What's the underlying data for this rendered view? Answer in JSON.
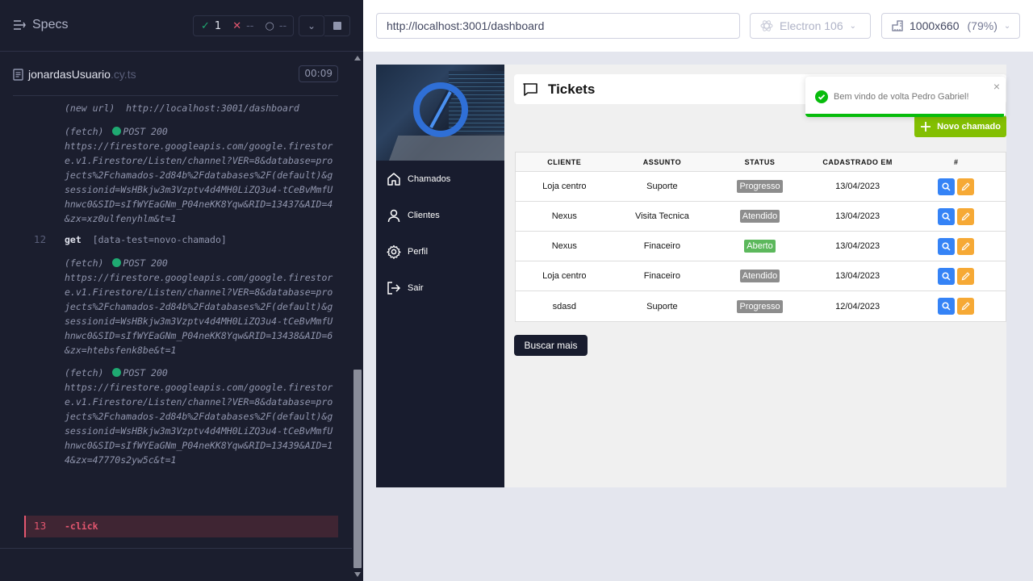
{
  "reporter": {
    "title": "Specs",
    "stats": {
      "passed": "1",
      "failed": "--",
      "pending": "--"
    },
    "file": {
      "name": "jonardasUsuario",
      "ext": ".cy.ts",
      "duration": "00:09"
    },
    "log": {
      "new_url": {
        "label": "(new url)",
        "url": "http://localhost:3001/dashboard"
      },
      "fetch1": {
        "label": "(fetch)",
        "method": "POST 200",
        "url": "https://firestore.googleapis.com/google.firestore.v1.Firestore/Listen/channel?VER=8&database=projects%2Fchamados-2d84b%2Fdatabases%2F(default)&gsessionid=WsHBkjw3m3Vzptv4d4MH0LiZQ3u4-tCeBvMmfUhnwc0&SID=sIfWYEaGNm_P04neKK8Yqw&RID=13437&AID=4&zx=xz0ulfenyhlm&t=1"
      },
      "get": {
        "num": "12",
        "cmd": "get",
        "selector": "[data-test=novo-chamado]"
      },
      "fetch2": {
        "label": "(fetch)",
        "method": "POST 200",
        "url": "https://firestore.googleapis.com/google.firestore.v1.Firestore/Listen/channel?VER=8&database=projects%2Fchamados-2d84b%2Fdatabases%2F(default)&gsessionid=WsHBkjw3m3Vzptv4d4MH0LiZQ3u4-tCeBvMmfUhnwc0&SID=sIfWYEaGNm_P04neKK8Yqw&RID=13438&AID=6&zx=htebsfenk8be&t=1"
      },
      "fetch3": {
        "label": "(fetch)",
        "method": "POST 200",
        "url": "https://firestore.googleapis.com/google.firestore.v1.Firestore/Listen/channel?VER=8&database=projects%2Fchamados-2d84b%2Fdatabases%2F(default)&gsessionid=WsHBkjw3m3Vzptv4d4MH0LiZQ3u4-tCeBvMmfUhnwc0&SID=sIfWYEaGNm_P04neKK8Yqw&RID=13439&AID=14&zx=47770s2yw5c&t=1"
      },
      "click": {
        "num": "13",
        "cmd": "-click"
      }
    }
  },
  "topbar": {
    "url": "http://localhost:3001/dashboard",
    "browser": "Electron 106",
    "viewport": "1000x660",
    "zoom": "(79%)"
  },
  "app": {
    "nav": [
      "Chamados",
      "Clientes",
      "Perfil",
      "Sair"
    ],
    "page_title": "Tickets",
    "new_button": "Novo chamado",
    "table": {
      "headers": [
        "CLIENTE",
        "ASSUNTO",
        "STATUS",
        "CADASTRADO EM",
        "#"
      ],
      "rows": [
        {
          "cliente": "Loja centro",
          "assunto": "Suporte",
          "status": "Progresso",
          "data": "13/04/2023"
        },
        {
          "cliente": "Nexus",
          "assunto": "Visita Tecnica",
          "status": "Atendido",
          "data": "13/04/2023"
        },
        {
          "cliente": "Nexus",
          "assunto": "Finaceiro",
          "status": "Aberto",
          "data": "13/04/2023"
        },
        {
          "cliente": "Loja centro",
          "assunto": "Finaceiro",
          "status": "Atendido",
          "data": "13/04/2023"
        },
        {
          "cliente": "sdasd",
          "assunto": "Suporte",
          "status": "Progresso",
          "data": "12/04/2023"
        }
      ]
    },
    "more_button": "Buscar mais",
    "toast": {
      "message": "Bem vindo de volta Pedro Gabriel!",
      "close": "×",
      "progress": 0.99
    }
  },
  "colors": {
    "accent_green": "#83bf02",
    "sidebar": "#181c2e",
    "view": "#3583f6",
    "edit": "#f6a935",
    "passed": "#1fa971",
    "failed": "#e45770"
  }
}
